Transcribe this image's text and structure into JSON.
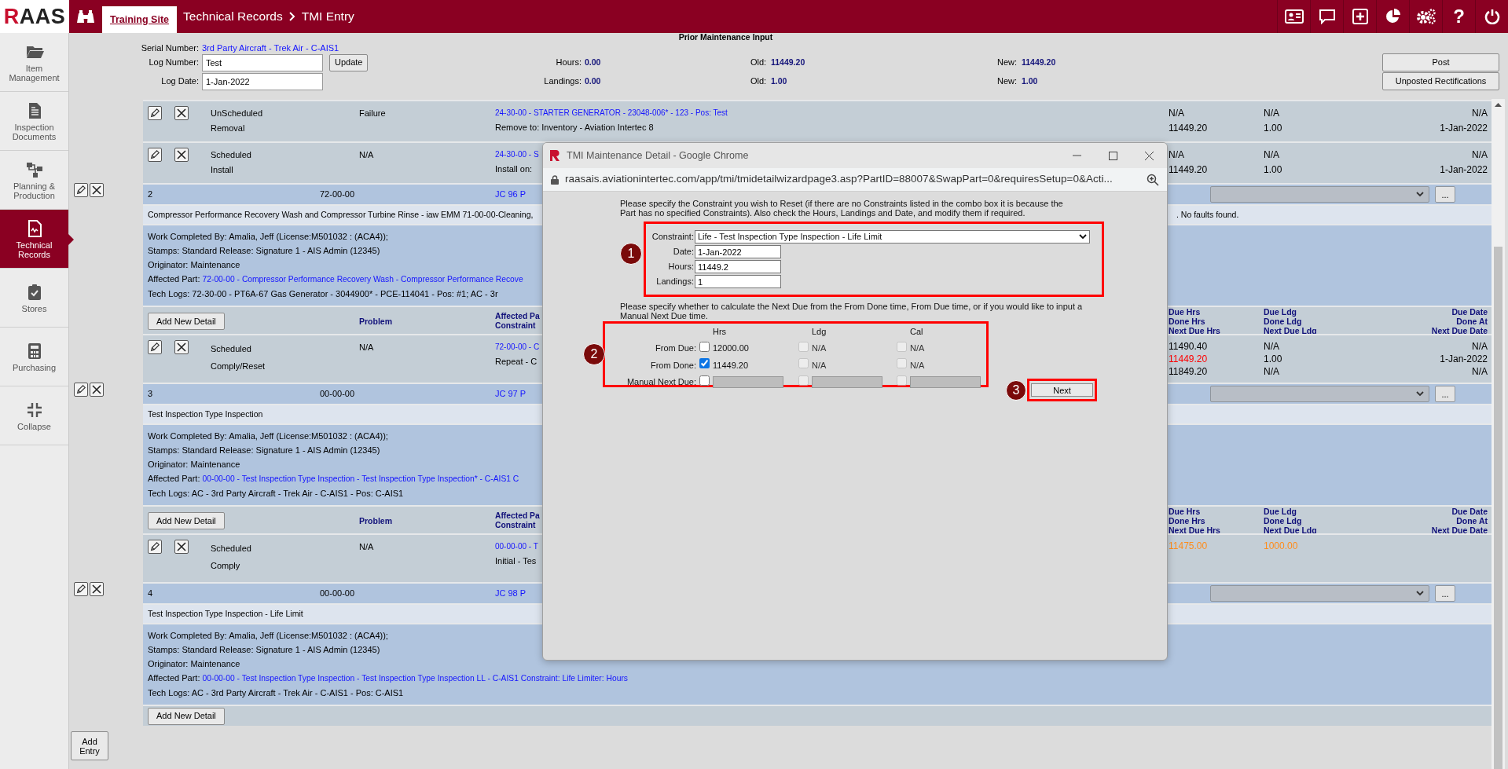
{
  "header": {
    "logo": "RAAS",
    "site_tab": "Training Site",
    "crumbs": [
      "Technical Records",
      "TMI Entry"
    ],
    "help": "?"
  },
  "sidebar": [
    {
      "label": "Item Management",
      "kind": "folder",
      "selected": false
    },
    {
      "label": "Inspection Documents",
      "kind": "document",
      "selected": false
    },
    {
      "label": "Planning & Production",
      "kind": "flow",
      "selected": false
    },
    {
      "label": "Technical Records",
      "kind": "records",
      "selected": true
    },
    {
      "label": "Stores",
      "kind": "clipboard",
      "selected": false
    },
    {
      "label": "Purchasing",
      "kind": "calculator",
      "selected": false
    },
    {
      "label": "Collapse",
      "kind": "collapse",
      "selected": false
    }
  ],
  "form": {
    "title": "Prior Maintenance Input",
    "serial_label": "Serial Number:",
    "serial_value": "3rd Party Aircraft - Trek Air - C-AIS1",
    "log_number": {
      "label": "Log Number:",
      "value": "Test"
    },
    "update_button": "Update",
    "log_date": {
      "label": "Log Date:",
      "value": "1-Jan-2022"
    },
    "meters": [
      {
        "label": "Hours:",
        "value": "0.00",
        "old_label": "Old:",
        "old": "11449.20",
        "new_label": "New:",
        "new": "11449.20"
      },
      {
        "label": "Landings:",
        "value": "0.00",
        "old_label": "Old:",
        "old": "1.00",
        "new_label": "New:",
        "new": "1.00"
      }
    ],
    "buttons": [
      "Post",
      "Unposted Rectifications"
    ]
  },
  "details": [
    {
      "type": "UnScheduled",
      "action": "Removal",
      "problem": "Failure",
      "part": "24-30-00 - STARTER GENERATOR - 23048-006* - 123 - Pos: Test",
      "note": "Remove to: Inventory - Aviation Intertec 8",
      "hrs": [
        {
          "text": "N/A",
          "color": "#000000"
        },
        {
          "text": "11449.20",
          "color": "#000000"
        }
      ],
      "ldg": [
        {
          "text": "N/A",
          "color": "#000000"
        },
        {
          "text": "1.00",
          "color": "#000000"
        }
      ],
      "date": [
        "N/A",
        "1-Jan-2022"
      ]
    },
    {
      "type": "Scheduled",
      "action": "Install",
      "problem": "N/A",
      "part": "24-30-00 - S",
      "note": "Install on:",
      "hrs": [
        {
          "text": "N/A",
          "color": "#000000"
        },
        {
          "text": "11449.20",
          "color": "#000000"
        }
      ],
      "ldg": [
        {
          "text": "N/A",
          "color": "#000000"
        },
        {
          "text": "1.00",
          "color": "#000000"
        }
      ],
      "date": [
        "N/A",
        "1-Jan-2022"
      ]
    }
  ],
  "entries": [
    {
      "number": "2",
      "ata": "72-00-00",
      "job_card": "JC 96 P",
      "more_button": "...",
      "description": "Compressor Performance Recovery Wash and Compressor Turbine Rinse - iaw EMM 71-00-00-Cleaning,",
      "description_tail": ". No faults found.",
      "lines": [
        {
          "kind": "text",
          "label": "Work Completed By:",
          "value": "Amalia, Jeff (License:M501032 : (ACA4));"
        },
        {
          "kind": "text",
          "label": "Stamps:",
          "value": "Standard Release: Signature 1 - AIS Admin (12345)"
        },
        {
          "kind": "text",
          "label": "Originator:",
          "value": "Maintenance"
        },
        {
          "kind": "link",
          "label": "Affected Part:",
          "value": "72-00-00 - Compressor Performance Recovery Wash - Compressor Performance Recove"
        },
        {
          "kind": "text",
          "label": "Tech Logs:",
          "value": "72-30-00 - PT6A-67 Gas Generator - 3044900* - PCE-114041 - Pos: #1; AC - 3r"
        }
      ],
      "detail_header": {
        "button": "Add New Detail",
        "problem": "Problem",
        "affected": [
          "Affected Pa",
          "Constraint"
        ],
        "hrs": [
          "Due Hrs",
          "Done Hrs",
          "Next Due Hrs"
        ],
        "ldg": [
          "Due Ldg",
          "Done Ldg",
          "Next Due Ldg"
        ],
        "date": [
          "Due Date",
          "Done At",
          "Next Due Date"
        ]
      },
      "details": [
        {
          "type": "Scheduled",
          "action": "Comply/Reset",
          "problem": "N/A",
          "part": "72-00-00 - C",
          "note": "Repeat - C",
          "hrs": [
            {
              "text": "11490.40",
              "color": "#000000"
            },
            {
              "text": "11449.20",
              "color": "#ff0000"
            },
            {
              "text": "11849.20",
              "color": "#000000"
            }
          ],
          "ldg": [
            {
              "text": "N/A",
              "color": "#000000"
            },
            {
              "text": "1.00",
              "color": "#000000"
            },
            {
              "text": "N/A",
              "color": "#000000"
            }
          ],
          "date": [
            "N/A",
            "1-Jan-2022",
            "N/A"
          ]
        }
      ]
    },
    {
      "number": "3",
      "ata": "00-00-00",
      "job_card": "JC 97 P",
      "more_button": "...",
      "description": "Test Inspection Type Inspection",
      "lines": [
        {
          "kind": "text",
          "label": "Work Completed By:",
          "value": "Amalia, Jeff (License:M501032 : (ACA4));"
        },
        {
          "kind": "text",
          "label": "Stamps:",
          "value": "Standard Release: Signature 1 - AIS Admin (12345)"
        },
        {
          "kind": "text",
          "label": "Originator:",
          "value": "Maintenance"
        },
        {
          "kind": "link",
          "label": "Affected Part:",
          "value": "00-00-00 - Test Inspection Type Inspection - Test Inspection Type Inspection* - C-AIS1 C"
        },
        {
          "kind": "text",
          "label": "Tech Logs:",
          "value": "AC - 3rd Party Aircraft - Trek Air - C-AIS1 - Pos: C-AIS1"
        }
      ],
      "detail_header": {
        "button": "Add New Detail",
        "problem": "Problem",
        "affected": [
          "Affected Pa",
          "Constraint"
        ],
        "hrs": [
          "Due Hrs",
          "Done Hrs",
          "Next Due Hrs"
        ],
        "ldg": [
          "Due Ldg",
          "Done Ldg",
          "Next Due Ldg"
        ],
        "date": [
          "Due Date",
          "Done At",
          "Next Due Date"
        ]
      },
      "details": [
        {
          "type": "Scheduled",
          "action": "Comply",
          "problem": "N/A",
          "part": "00-00-00 - T",
          "note": "Initial - Tes",
          "hrs": [
            {
              "text": "11475.00",
              "color": "#ff8c1a"
            }
          ],
          "ldg": [
            {
              "text": "1000.00",
              "color": "#ff8c1a"
            }
          ]
        }
      ]
    },
    {
      "number": "4",
      "ata": "00-00-00",
      "job_card": "JC 98 P",
      "more_button": "...",
      "description": "Test Inspection Type Inspection - Life Limit",
      "lines": [
        {
          "kind": "text",
          "label": "Work Completed By:",
          "value": "Amalia, Jeff (License:M501032 : (ACA4));"
        },
        {
          "kind": "text",
          "label": "Stamps:",
          "value": "Standard Release: Signature 1 - AIS Admin (12345)"
        },
        {
          "kind": "text",
          "label": "Originator:",
          "value": "Maintenance"
        },
        {
          "kind": "link",
          "label": "Affected Part:",
          "value": "00-00-00 - Test Inspection Type Inspection - Test Inspection Type Inspection LL - C-AIS1 Constraint: Life Limiter: Hours"
        },
        {
          "kind": "text",
          "label": "Tech Logs:",
          "value": "AC - 3rd Party Aircraft - Trek Air - C-AIS1 - Pos: C-AIS1"
        }
      ],
      "detail_header": {
        "button": "Add New Detail"
      }
    }
  ],
  "add_entry_button": "Add Entry",
  "dialog": {
    "title": "TMI Maintenance Detail - Google Chrome",
    "url": "raasais.aviationintertec.com/app/tmi/tmidetailwizardpage3.asp?PartID=88007&SwapPart=0&requiresSetup=0&Acti...",
    "intro": "Please specify the Constraint you wish to Reset (if there are no Constraints listed in the combo box it is because the Part has no specified Constraints). Also check the Hours, Landings and Date, and modify them if required.",
    "fields": [
      {
        "label": "Constraint:",
        "value": "Life - Test Inspection Type Inspection - Life Limit",
        "kind": "select"
      },
      {
        "label": "Date:",
        "value": "1-Jan-2022",
        "kind": "text"
      },
      {
        "label": "Hours:",
        "value": "11449.2",
        "kind": "text"
      },
      {
        "label": "Landings:",
        "value": "1",
        "kind": "text"
      }
    ],
    "prompt": "Please specify whether to calculate the Next Due from the From Done time, From Due time, or if you would like to input a Manual Next Due time.",
    "columns": [
      "Hrs",
      "Ldg",
      "Cal"
    ],
    "rows": [
      {
        "label": "From Due:",
        "cells": [
          {
            "kind": "value",
            "checked": false,
            "disabled": false,
            "value": "12000.00"
          },
          {
            "kind": "value",
            "checked": false,
            "disabled": true,
            "value": "N/A"
          },
          {
            "kind": "value",
            "checked": false,
            "disabled": true,
            "value": "N/A"
          }
        ]
      },
      {
        "label": "From Done:",
        "cells": [
          {
            "kind": "value",
            "checked": true,
            "disabled": false,
            "value": "11449.20"
          },
          {
            "kind": "value",
            "checked": false,
            "disabled": true,
            "value": "N/A"
          },
          {
            "kind": "value",
            "checked": false,
            "disabled": true,
            "value": "N/A"
          }
        ]
      },
      {
        "label": "Manual Next Due:",
        "cells": [
          {
            "kind": "field",
            "checked": false,
            "disabled": false
          },
          {
            "kind": "field",
            "checked": false,
            "disabled": true
          },
          {
            "kind": "field",
            "checked": false,
            "disabled": true
          }
        ]
      }
    ],
    "next_button": "Next",
    "callouts": [
      "1",
      "2",
      "3"
    ]
  }
}
